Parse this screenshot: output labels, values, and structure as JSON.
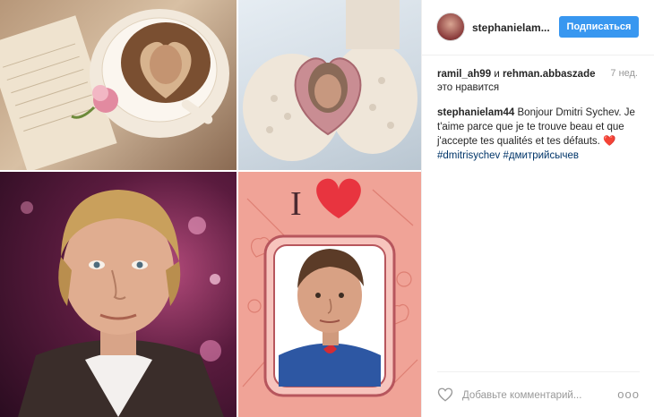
{
  "post": {
    "username": "stephanielam...",
    "follow_label": "Подписаться",
    "likes": {
      "user1": "ramil_ah99",
      "conj": "и",
      "user2": "rehman.abbaszade",
      "suffix": "это нравится"
    },
    "time": "7 нед.",
    "caption": {
      "user": "stephanielam44",
      "text": "Bonjour Dmitri Sychev. Je t'aime parce que je te trouve beau et que j'accepte tes qualités et tes défauts. ❤️",
      "hashtag1": "#dmitrisychev",
      "hashtag2": "#дмитрийсычев"
    },
    "comment_placeholder": "Добавьте комментарий...",
    "more_label": "ooo"
  },
  "icons": {
    "like": "heart-outline-icon",
    "more": "more-options-icon"
  },
  "colors": {
    "follow_button": "#3897f0",
    "hashtag": "#003569",
    "muted": "#999999"
  }
}
